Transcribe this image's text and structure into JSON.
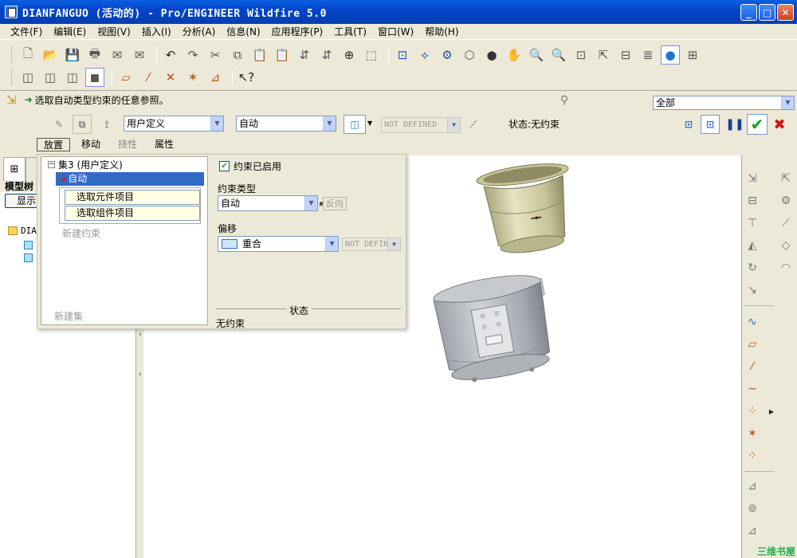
{
  "window": {
    "title": "DIANFANGUO (活动的) - Pro/ENGINEER Wildfire 5.0",
    "buttons": [
      "minimize",
      "maximize",
      "close"
    ]
  },
  "menu": [
    "文件(F)",
    "编辑(E)",
    "视图(V)",
    "插入(I)",
    "分析(A)",
    "信息(N)",
    "应用程序(P)",
    "工具(T)",
    "窗口(W)",
    "帮助(H)"
  ],
  "toolbar1_icons": [
    "new-icon",
    "open-icon",
    "save-icon",
    "print-icon",
    "email-icon",
    "email-link-icon",
    "undo-icon",
    "redo-icon",
    "cut-icon",
    "copy-icon",
    "paste-icon",
    "paste-special-icon",
    "regenerate-icon",
    "regenerate-manager-icon",
    "find-icon",
    "select-box-icon",
    "repaint-icon",
    "spin-center-icon",
    "orient-icon",
    "saved-views-icon",
    "appearance-icon",
    "pan-icon",
    "zoom-in-icon",
    "zoom-out-icon",
    "refit-icon",
    "reorient-icon",
    "view-manager-icon",
    "layers-icon",
    "model-display-icon",
    "setup-icon"
  ],
  "toolbar2_icons": [
    "wireframe-icon",
    "hidden-line-icon",
    "no-hidden-icon",
    "shading-icon",
    "datum-planes-icon",
    "datum-axes-icon",
    "datum-points-icon",
    "coord-sys-icon",
    "annotations-icon",
    "context-help-icon"
  ],
  "dashboard": {
    "prompt": "选取自动类型约束的任意参照。",
    "filter": "全部",
    "constraint_set_type": "用户定义",
    "constraint_type": "自动",
    "offset_disabled": "NOT DEFINED",
    "status": "状态:无约束",
    "tabs": [
      "放置",
      "移动",
      "挠性",
      "属性"
    ],
    "active_tab": "放置",
    "disabled_tab": "挠性"
  },
  "model_tree": {
    "tab_label": "模型树",
    "show_button": "显示",
    "root": "DIA"
  },
  "placement_panel": {
    "set_title": "集3 (用户定义)",
    "selected_constraint": "自动",
    "ref_items": [
      "选取元件项目",
      "选取组件项目"
    ],
    "new_constraint": "新建约束",
    "new_set": "新建集",
    "constraint_enabled": "约束已启用",
    "constraint_type_label": "约束类型",
    "constraint_type_value": "自动",
    "flip_button": "反向",
    "offset_label": "偏移",
    "offset_value": "重合",
    "offset_disabled": "NOT DEFIN",
    "status_label": "状态",
    "status_value": "无约束"
  },
  "watermark": "三维书屋",
  "colors": {
    "titlebar": "#0544C9",
    "selection": "#316AC5",
    "model_top": "#D8D6A8",
    "model_body": "#B0B4B8"
  }
}
